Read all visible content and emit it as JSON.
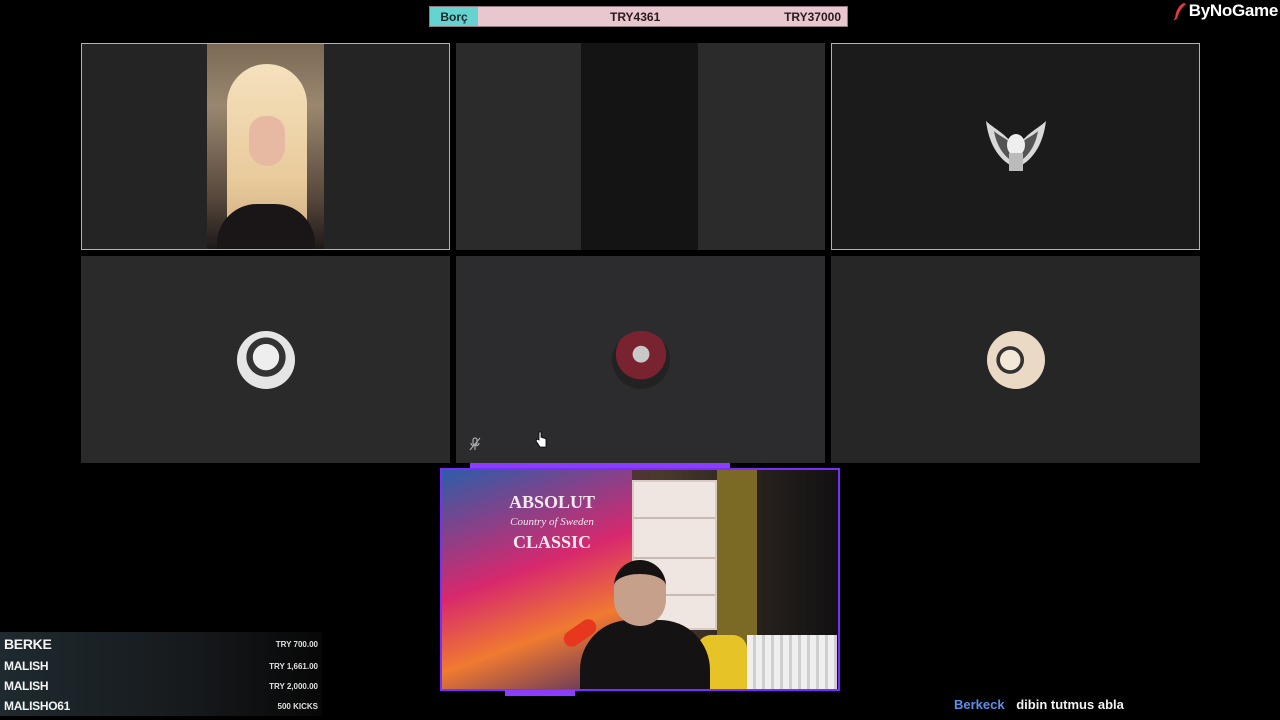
{
  "debt_bar": {
    "label": "Borç",
    "current": "TRY4361",
    "target": "TRY37000"
  },
  "brand": {
    "name": "ByNoGame",
    "icon": "feather-icon"
  },
  "tiles": [
    {
      "kind": "camera",
      "speaking": true
    },
    {
      "kind": "camera-dark",
      "speaking": false
    },
    {
      "kind": "avatar",
      "avatar": "winged-skull-avatar",
      "speaking": true
    },
    {
      "kind": "avatar",
      "avatar": "rapper-avatar",
      "speaking": false
    },
    {
      "kind": "avatar",
      "avatar": "hooded-assassin-avatar",
      "speaking": false,
      "muted_icon": "mic-off-icon"
    },
    {
      "kind": "avatar",
      "avatar": "couple-avatar",
      "speaking": false
    }
  ],
  "streamer": {
    "poster_title_1": "ABSOLUT",
    "poster_sub": "Country of Sweden",
    "poster_title_2": "CLASSIC",
    "frame_color": "#7b2cff"
  },
  "donations": [
    {
      "name": "BERKE",
      "amount": "TRY 700.00"
    },
    {
      "name": "MALISH",
      "amount": "TRY 1,661.00"
    },
    {
      "name": "MALISH",
      "amount": "TRY 2,000.00"
    },
    {
      "name": "MALISHO61",
      "amount": "500 KICKS"
    }
  ],
  "chat": {
    "user": "Berkeck",
    "message": "dibin tutmus abla"
  },
  "colors": {
    "active_border": "#6ee07a",
    "debt_label_bg": "#66d3d0",
    "debt_bar_bg": "#e9c7cf",
    "chat_user": "#5b8fe8"
  }
}
